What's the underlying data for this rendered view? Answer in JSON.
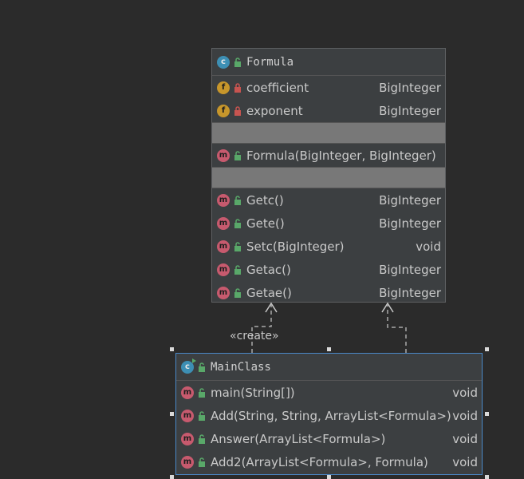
{
  "colors": {
    "background": "#2b2b2b",
    "box": "#3c3f41",
    "selection": "#4a88c7",
    "class_icon": "#3d8fb4",
    "field_icon": "#c7962b",
    "method_icon": "#c75a6e"
  },
  "formula": {
    "name": "Formula",
    "fields": [
      {
        "name": "coefficient",
        "type": "BigInteger",
        "icon": "field-icon",
        "visibility": "private"
      },
      {
        "name": "exponent",
        "type": "BigInteger",
        "icon": "field-icon",
        "visibility": "private"
      }
    ],
    "constructors": [
      {
        "name": "Formula(BigInteger, BigInteger)",
        "type": "",
        "icon": "method-icon",
        "visibility": "public"
      }
    ],
    "methods": [
      {
        "name": "Getc()",
        "type": "BigInteger",
        "icon": "method-icon",
        "visibility": "public"
      },
      {
        "name": "Gete()",
        "type": "BigInteger",
        "icon": "method-icon",
        "visibility": "public"
      },
      {
        "name": "Setc(BigInteger)",
        "type": "void",
        "icon": "method-icon",
        "visibility": "public"
      },
      {
        "name": "Getac()",
        "type": "BigInteger",
        "icon": "method-icon",
        "visibility": "public"
      },
      {
        "name": "Getae()",
        "type": "BigInteger",
        "icon": "method-icon",
        "visibility": "public"
      }
    ]
  },
  "mainclass": {
    "name": "MainClass",
    "methods": [
      {
        "name": "main(String[])",
        "type": "void",
        "icon": "method-icon",
        "visibility": "public"
      },
      {
        "name": "Add(String, String, ArrayList<Formula>)",
        "type": "void",
        "icon": "method-icon",
        "visibility": "public"
      },
      {
        "name": "Answer(ArrayList<Formula>)",
        "type": "void",
        "icon": "method-icon",
        "visibility": "public"
      },
      {
        "name": "Add2(ArrayList<Formula>, Formula)",
        "type": "void",
        "icon": "method-icon",
        "visibility": "public"
      }
    ]
  },
  "relations": [
    {
      "from": "MainClass",
      "to": "Formula",
      "label": "«create»",
      "style": "dashed"
    },
    {
      "from": "MainClass",
      "to": "Formula",
      "label": "",
      "style": "dashed"
    }
  ]
}
